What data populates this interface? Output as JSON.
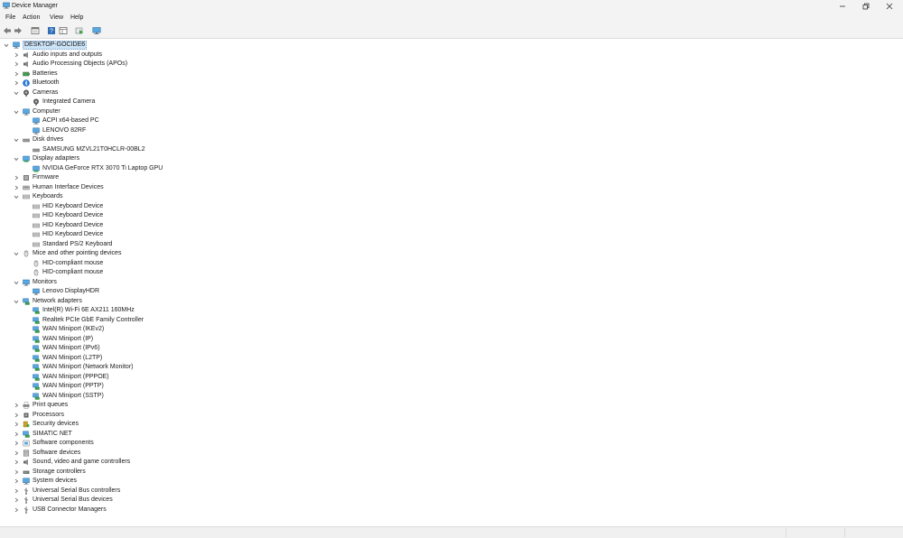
{
  "window": {
    "title": "Device Manager",
    "icon": "device-manager-icon",
    "controls": [
      "minimize-icon",
      "restore-icon",
      "close-icon"
    ]
  },
  "menu": {
    "items": [
      "File",
      "Action",
      "View",
      "Help"
    ]
  },
  "toolbar": {
    "buttons": [
      "back-arrow-icon",
      "forward-arrow-icon",
      "properties-icon",
      "help-icon",
      "view-icon",
      "update-driver-icon",
      "monitor-scan-icon"
    ]
  },
  "colors": {
    "chrome_bg": "#f3f3f3",
    "selection_bg": "#cce4f7",
    "text": "#1a1a1a"
  },
  "tree": {
    "root": "DESKTOP-GOCIDE6",
    "categories": [
      {
        "label": "Audio inputs and outputs",
        "icon": "speaker-icon",
        "expanded": false,
        "children": []
      },
      {
        "label": "Audio Processing Objects (APOs)",
        "icon": "speaker-icon",
        "expanded": false,
        "children": []
      },
      {
        "label": "Batteries",
        "icon": "battery-icon",
        "expanded": false,
        "children": []
      },
      {
        "label": "Bluetooth",
        "icon": "bluetooth-icon",
        "expanded": false,
        "children": []
      },
      {
        "label": "Cameras",
        "icon": "camera-icon",
        "expanded": true,
        "children": [
          {
            "label": "Integrated Camera",
            "icon": "camera-icon"
          }
        ]
      },
      {
        "label": "Computer",
        "icon": "computer-icon",
        "expanded": true,
        "children": [
          {
            "label": "ACPI x64-based PC",
            "icon": "computer-icon"
          },
          {
            "label": "LENOVO 82RF",
            "icon": "computer-icon"
          }
        ]
      },
      {
        "label": "Disk drives",
        "icon": "disk-icon",
        "expanded": true,
        "children": [
          {
            "label": "SAMSUNG MZVL21T0HCLR-00BL2",
            "icon": "disk-icon"
          }
        ]
      },
      {
        "label": "Display adapters",
        "icon": "display-adapter-icon",
        "expanded": true,
        "children": [
          {
            "label": "NVIDIA GeForce RTX 3070 Ti Laptop GPU",
            "icon": "display-adapter-icon"
          }
        ]
      },
      {
        "label": "Firmware",
        "icon": "firmware-icon",
        "expanded": false,
        "children": []
      },
      {
        "label": "Human Interface Devices",
        "icon": "hid-icon",
        "expanded": false,
        "children": []
      },
      {
        "label": "Keyboards",
        "icon": "keyboard-icon",
        "expanded": true,
        "children": [
          {
            "label": "HID Keyboard Device",
            "icon": "keyboard-icon"
          },
          {
            "label": "HID Keyboard Device",
            "icon": "keyboard-icon"
          },
          {
            "label": "HID Keyboard Device",
            "icon": "keyboard-icon"
          },
          {
            "label": "HID Keyboard Device",
            "icon": "keyboard-icon"
          },
          {
            "label": "Standard PS/2 Keyboard",
            "icon": "keyboard-icon"
          }
        ]
      },
      {
        "label": "Mice and other pointing devices",
        "icon": "mouse-icon",
        "expanded": true,
        "children": [
          {
            "label": "HID-compliant mouse",
            "icon": "mouse-icon"
          },
          {
            "label": "HID-compliant mouse",
            "icon": "mouse-icon"
          }
        ]
      },
      {
        "label": "Monitors",
        "icon": "monitor-icon",
        "expanded": true,
        "children": [
          {
            "label": "Lenovo DisplayHDR",
            "icon": "monitor-icon"
          }
        ]
      },
      {
        "label": "Network adapters",
        "icon": "network-icon",
        "expanded": true,
        "children": [
          {
            "label": "Intel(R) Wi-Fi 6E AX211 160MHz",
            "icon": "network-icon"
          },
          {
            "label": "Realtek PCIe GbE Family Controller",
            "icon": "network-icon"
          },
          {
            "label": "WAN Miniport (IKEv2)",
            "icon": "network-icon"
          },
          {
            "label": "WAN Miniport (IP)",
            "icon": "network-icon"
          },
          {
            "label": "WAN Miniport (IPv6)",
            "icon": "network-icon"
          },
          {
            "label": "WAN Miniport (L2TP)",
            "icon": "network-icon"
          },
          {
            "label": "WAN Miniport (Network Monitor)",
            "icon": "network-icon"
          },
          {
            "label": "WAN Miniport (PPPOE)",
            "icon": "network-icon"
          },
          {
            "label": "WAN Miniport (PPTP)",
            "icon": "network-icon"
          },
          {
            "label": "WAN Miniport (SSTP)",
            "icon": "network-icon"
          }
        ]
      },
      {
        "label": "Print queues",
        "icon": "printer-icon",
        "expanded": false,
        "children": []
      },
      {
        "label": "Processors",
        "icon": "processor-icon",
        "expanded": false,
        "children": []
      },
      {
        "label": "Security devices",
        "icon": "security-icon",
        "expanded": false,
        "children": []
      },
      {
        "label": "SIMATIC NET",
        "icon": "network-icon",
        "expanded": false,
        "children": []
      },
      {
        "label": "Software components",
        "icon": "software-component-icon",
        "expanded": false,
        "children": []
      },
      {
        "label": "Software devices",
        "icon": "software-device-icon",
        "expanded": false,
        "children": []
      },
      {
        "label": "Sound, video and game controllers",
        "icon": "speaker-icon",
        "expanded": false,
        "children": []
      },
      {
        "label": "Storage controllers",
        "icon": "storage-icon",
        "expanded": false,
        "children": []
      },
      {
        "label": "System devices",
        "icon": "computer-icon",
        "expanded": false,
        "children": []
      },
      {
        "label": "Universal Serial Bus controllers",
        "icon": "usb-icon",
        "expanded": false,
        "children": []
      },
      {
        "label": "Universal Serial Bus devices",
        "icon": "usb-icon",
        "expanded": false,
        "children": []
      },
      {
        "label": "USB Connector Managers",
        "icon": "usb-icon",
        "expanded": false,
        "children": []
      }
    ]
  }
}
